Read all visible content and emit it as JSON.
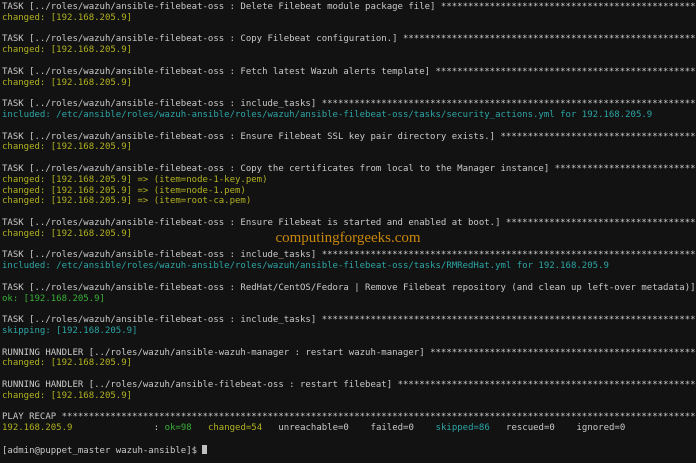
{
  "colors": {
    "bg": "#121212",
    "plain": "#c9c9c9",
    "changed": "#b1b121",
    "ok": "#38b038",
    "cyan": "#2da5a5",
    "watermark": "#c8860a",
    "cursor": "#c0c0c0"
  },
  "watermark": {
    "text": "computingforgeeks.com"
  },
  "terminal": {
    "lines": [
      [
        {
          "n": "task-header",
          "c": "plain",
          "t": "TASK [../roles/wazuh/ansible-filebeat-oss : Delete Filebeat module package file] "
        },
        {
          "stars": 47
        }
      ],
      [
        {
          "n": "status-changed",
          "c": "changed",
          "t": "changed: [192.168.205.9]"
        }
      ],
      [],
      [
        {
          "n": "task-header",
          "c": "plain",
          "t": "TASK [../roles/wazuh/ansible-filebeat-oss : Copy Filebeat configuration.] "
        },
        {
          "stars": 54
        }
      ],
      [
        {
          "n": "status-changed",
          "c": "changed",
          "t": "changed: [192.168.205.9]"
        }
      ],
      [],
      [
        {
          "n": "task-header",
          "c": "plain",
          "t": "TASK [../roles/wazuh/ansible-filebeat-oss : Fetch latest Wazuh alerts template] "
        },
        {
          "stars": 49
        }
      ],
      [
        {
          "n": "status-changed",
          "c": "changed",
          "t": "changed: [192.168.205.9]"
        }
      ],
      [],
      [
        {
          "n": "task-header",
          "c": "plain",
          "t": "TASK [../roles/wazuh/ansible-filebeat-oss : include_tasks] "
        },
        {
          "stars": 69
        }
      ],
      [
        {
          "n": "status-included",
          "c": "cyan",
          "t": "included: /etc/ansible/roles/wazuh-ansible/roles/wazuh/ansible-filebeat-oss/tasks/security_actions.yml for 192.168.205.9"
        }
      ],
      [],
      [
        {
          "n": "task-header",
          "c": "plain",
          "t": "TASK [../roles/wazuh/ansible-filebeat-oss : Ensure Filebeat SSL key pair directory exists.] "
        },
        {
          "stars": 36
        }
      ],
      [
        {
          "n": "status-changed",
          "c": "changed",
          "t": "changed: [192.168.205.9]"
        }
      ],
      [],
      [
        {
          "n": "task-header",
          "c": "plain",
          "t": "TASK [../roles/wazuh/ansible-filebeat-oss : Copy the certificates from local to the Manager instance] "
        },
        {
          "stars": 26
        }
      ],
      [
        {
          "n": "status-changed",
          "c": "changed",
          "t": "changed: [192.168.205.9] => (item=node-1-key.pem)"
        }
      ],
      [
        {
          "n": "status-changed",
          "c": "changed",
          "t": "changed: [192.168.205.9] => (item=node-1.pem)"
        }
      ],
      [
        {
          "n": "status-changed",
          "c": "changed",
          "t": "changed: [192.168.205.9] => (item=root-ca.pem)"
        }
      ],
      [],
      [
        {
          "n": "task-header",
          "c": "plain",
          "t": "TASK [../roles/wazuh/ansible-filebeat-oss : Ensure Filebeat is started and enabled at boot.] "
        },
        {
          "stars": 35
        }
      ],
      [
        {
          "n": "status-changed",
          "c": "changed",
          "t": "changed: [192.168.205.9]"
        }
      ],
      [],
      [
        {
          "n": "task-header",
          "c": "plain",
          "t": "TASK [../roles/wazuh/ansible-filebeat-oss : include_tasks] "
        },
        {
          "stars": 69
        }
      ],
      [
        {
          "n": "status-included",
          "c": "cyan",
          "t": "included: /etc/ansible/roles/wazuh-ansible/roles/wazuh/ansible-filebeat-oss/tasks/RMRedHat.yml for 192.168.205.9"
        }
      ],
      [],
      [
        {
          "n": "task-header",
          "c": "plain",
          "t": "TASK [../roles/wazuh/ansible-filebeat-oss : RedHat/CentOS/Fedora | Remove Filebeat repository (and clean up left-over metadata)] "
        }
      ],
      [
        {
          "n": "status-ok",
          "c": "ok",
          "t": "ok: [192.168.205.9]"
        }
      ],
      [],
      [
        {
          "n": "task-header",
          "c": "plain",
          "t": "TASK [../roles/wazuh/ansible-filebeat-oss : include_tasks] "
        },
        {
          "stars": 69
        }
      ],
      [
        {
          "n": "status-skipping",
          "c": "cyan",
          "t": "skipping: [192.168.205.9]"
        }
      ],
      [],
      [
        {
          "n": "handler-header",
          "c": "plain",
          "t": "RUNNING HANDLER [../roles/wazuh/ansible-wazuh-manager : restart wazuh-manager] "
        },
        {
          "stars": 49
        }
      ],
      [
        {
          "n": "status-changed",
          "c": "changed",
          "t": "changed: [192.168.205.9]"
        }
      ],
      [],
      [
        {
          "n": "handler-header",
          "c": "plain",
          "t": "RUNNING HANDLER [../roles/wazuh/ansible-filebeat-oss : restart filebeat] "
        },
        {
          "stars": 55
        }
      ],
      [
        {
          "n": "status-changed",
          "c": "changed",
          "t": "changed: [192.168.205.9]"
        }
      ],
      [],
      [
        {
          "n": "play-recap-header",
          "c": "plain",
          "t": "PLAY RECAP "
        },
        {
          "stars": 117
        }
      ],
      [
        {
          "n": "recap-host",
          "c": "changed",
          "t": "192.168.205.9"
        },
        {
          "n": "recap-separator",
          "c": "plain",
          "t": "               : "
        },
        {
          "n": "recap-ok",
          "c": "ok",
          "t": "ok=98"
        },
        {
          "n": "recap-gap",
          "c": "plain",
          "t": "   "
        },
        {
          "n": "recap-changed",
          "c": "changed",
          "t": "changed=54"
        },
        {
          "n": "recap-gap",
          "c": "plain",
          "t": "   "
        },
        {
          "n": "recap-unreachable",
          "c": "plain",
          "t": "unreachable=0"
        },
        {
          "n": "recap-gap",
          "c": "plain",
          "t": "    "
        },
        {
          "n": "recap-failed",
          "c": "plain",
          "t": "failed=0"
        },
        {
          "n": "recap-gap",
          "c": "plain",
          "t": "    "
        },
        {
          "n": "recap-skipped",
          "c": "cyan",
          "t": "skipped=86"
        },
        {
          "n": "recap-gap",
          "c": "plain",
          "t": "   "
        },
        {
          "n": "recap-rescued",
          "c": "plain",
          "t": "rescued=0"
        },
        {
          "n": "recap-gap",
          "c": "plain",
          "t": "    "
        },
        {
          "n": "recap-ignored",
          "c": "plain",
          "t": "ignored=0"
        }
      ],
      [],
      [
        {
          "n": "shell-prompt",
          "c": "plain",
          "t": "[admin@puppet_master wazuh-ansible]$ "
        },
        {
          "cursor": true
        }
      ]
    ]
  }
}
